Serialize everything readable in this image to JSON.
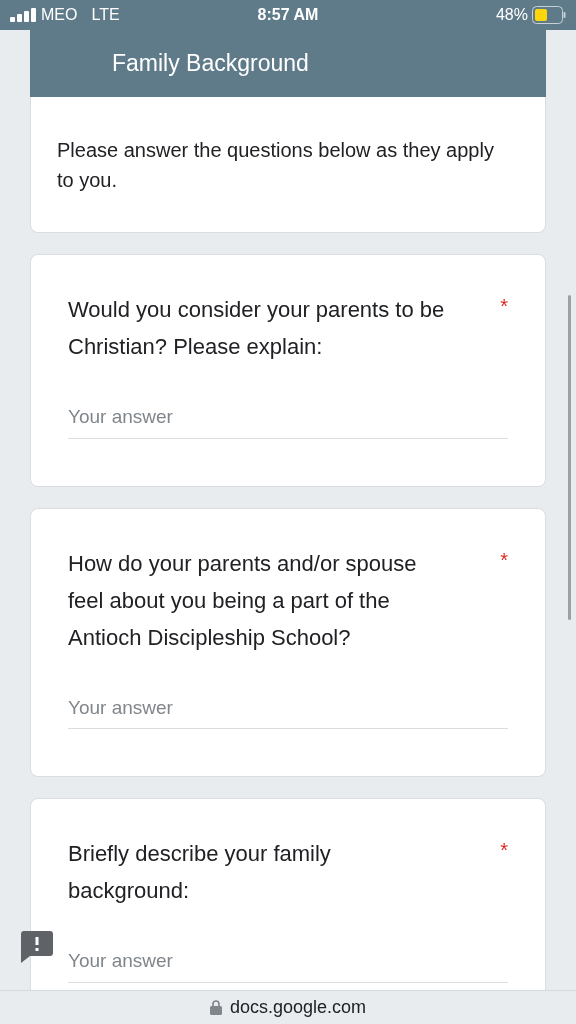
{
  "status_bar": {
    "carrier": "MEO",
    "network": "LTE",
    "time": "8:57 AM",
    "battery": "48%"
  },
  "form": {
    "section_title": "Family Background",
    "description": "Please answer the questions below as they apply to you.",
    "questions": [
      {
        "text": "Would you consider your parents to be Christian? Please explain:",
        "required": true,
        "placeholder": "Your answer"
      },
      {
        "text": "How do your parents and/or spouse feel about you being a part of the Antioch Discipleship School?",
        "required": true,
        "placeholder": "Your answer"
      },
      {
        "text": "Briefly describe your family background:",
        "required": true,
        "placeholder": "Your answer"
      }
    ],
    "required_mark": "*"
  },
  "address_bar": {
    "url": "docs.google.com"
  }
}
